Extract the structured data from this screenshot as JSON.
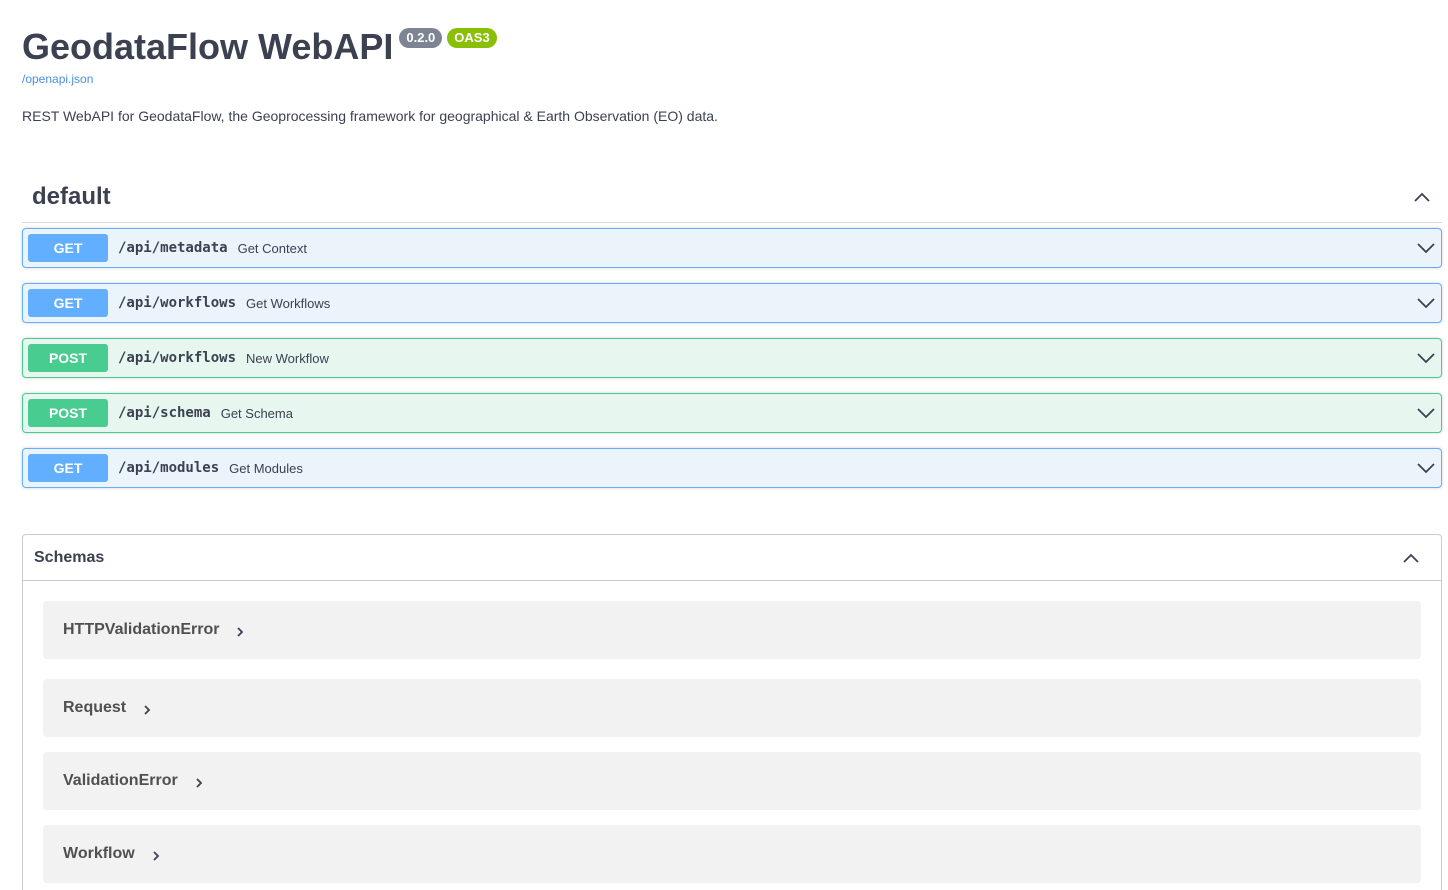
{
  "info": {
    "title": "GeodataFlow WebAPI",
    "version": "0.2.0",
    "oas_badge": "OAS3",
    "spec_link": "/openapi.json",
    "description": "REST WebAPI for GeodataFlow, the Geoprocessing framework for geographical & Earth Observation (EO) data."
  },
  "tag": {
    "name": "default",
    "operations": [
      {
        "method": "GET",
        "path": "/api/metadata",
        "summary": "Get Context"
      },
      {
        "method": "GET",
        "path": "/api/workflows",
        "summary": "Get Workflows"
      },
      {
        "method": "POST",
        "path": "/api/workflows",
        "summary": "New Workflow"
      },
      {
        "method": "POST",
        "path": "/api/schema",
        "summary": "Get Schema"
      },
      {
        "method": "GET",
        "path": "/api/modules",
        "summary": "Get Modules"
      }
    ]
  },
  "schemas": {
    "title": "Schemas",
    "models": [
      {
        "name": "HTTPValidationError"
      },
      {
        "name": "Request"
      },
      {
        "name": "ValidationError"
      },
      {
        "name": "Workflow"
      }
    ]
  },
  "colors": {
    "text": "#3b4151",
    "link": "#4990e2",
    "version_badge": "#7d8492",
    "oas_badge": "#89bf04",
    "get_method": "#61affe",
    "get_bg": "#ebf3fb",
    "post_method": "#49cc90",
    "post_bg": "#e8f6f0",
    "model_bg": "#f2f2f2"
  },
  "icons": {
    "collapse": "chevron-up-icon",
    "expand": "chevron-down-icon",
    "model_expand": "chevron-right-icon"
  }
}
